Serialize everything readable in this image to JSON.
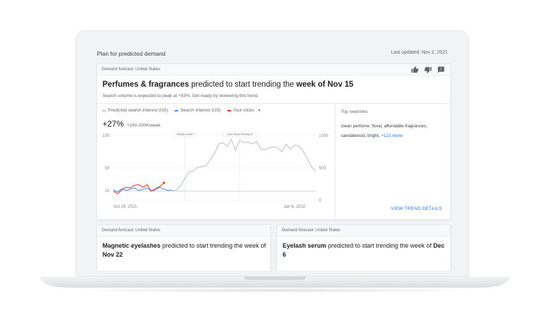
{
  "page": {
    "title": "Plan for predicted demand",
    "last_updated": "Last updated: Nov 2, 2021"
  },
  "main_card": {
    "label": "Demand forecast: United States",
    "headline": {
      "subject": "Perfumes & fragrances",
      "middle": " predicted to start trending the ",
      "when": "week of Nov 15"
    },
    "subline": "Search volume is expected to peak at +93%. Get ready by reviewing this trend.",
    "legend": {
      "predicted": "Predicted search interest (US)",
      "interest": "Search interest (US)",
      "clicks": "Your clicks"
    },
    "metric": {
      "change": "+27%",
      "range": "+100-200K/week"
    },
    "top_searches": {
      "title": "Top searches",
      "text": "clean perfume, floral, affordable fragrances, sandalwood, bright, ",
      "more": "+121 more"
    },
    "view_details": "VIEW TREND DETAILS",
    "feedback_icons": [
      "thumb-up-icon",
      "thumb-down-icon",
      "comment-icon"
    ]
  },
  "chart_data": {
    "type": "line",
    "left_ticks": [
      "100",
      "50",
      "14"
    ],
    "right_ticks": [
      "1000",
      "500",
      "0"
    ],
    "x_ticks": [
      "Oct 26, 2021",
      "Jan 6, 2022"
    ],
    "annotations": [
      "TREND START",
      "+93% PEAK INTEREST"
    ],
    "ylim_left": [
      0,
      100
    ],
    "ylim_right": [
      0,
      1000
    ],
    "series": [
      {
        "name": "Predicted search interest (US)",
        "color": "#bdc1c6",
        "x": [
          14,
          15,
          16,
          17,
          18,
          19,
          20,
          21,
          22,
          23,
          24,
          25,
          26,
          27,
          28,
          29,
          30,
          31,
          32,
          33,
          34,
          35,
          36,
          37,
          38,
          39,
          40,
          41,
          42,
          43,
          44,
          45,
          46,
          47,
          48
        ],
        "y": [
          14,
          16,
          23,
          34,
          44,
          45,
          51,
          52,
          53,
          63,
          72,
          87,
          89,
          83,
          94,
          77,
          93,
          89,
          90,
          87,
          91,
          79,
          78,
          81,
          83,
          81,
          75,
          87,
          79,
          85,
          84,
          76,
          65,
          52,
          45
        ]
      },
      {
        "name": "Search interest (US)",
        "color": "#4285f4",
        "x": [
          0,
          1,
          2,
          3,
          4,
          5,
          6,
          7,
          8,
          9,
          10,
          11,
          12,
          13,
          14
        ],
        "y": [
          16,
          13,
          18,
          15,
          17,
          19,
          15,
          17,
          19,
          14,
          16,
          20,
          17,
          15,
          16
        ]
      },
      {
        "name": "Your clicks",
        "color": "#d93025",
        "x": [
          0,
          1,
          2,
          3,
          4,
          5,
          6,
          7,
          8,
          9,
          10,
          11,
          12
        ],
        "y": [
          14,
          10,
          16,
          20,
          19,
          23,
          24,
          20,
          24,
          14,
          18,
          21,
          27
        ]
      }
    ]
  },
  "cards": [
    {
      "label": "Demand forecast: United States",
      "subject": "Magnetic eyelashes",
      "middle": " predicted to start trending the week of ",
      "when": "Nov 22"
    },
    {
      "label": "Demand forecast: United States",
      "subject": "Eyelash serum",
      "middle": " predicted to start trending the week of ",
      "when": "Dec 6"
    }
  ]
}
